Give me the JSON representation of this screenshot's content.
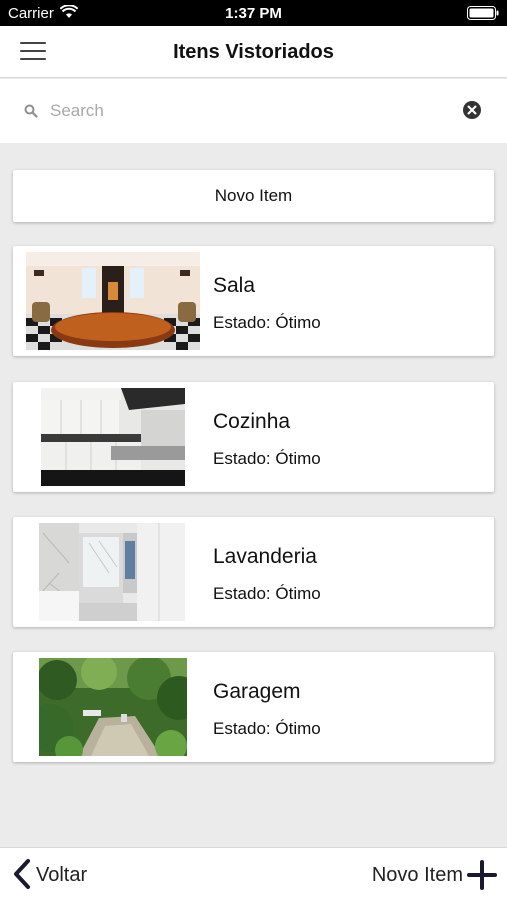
{
  "status_bar": {
    "carrier": "Carrier",
    "time": "1:37 PM"
  },
  "nav": {
    "title": "Itens Vistoriados",
    "menu_icon": "hamburger-menu-icon"
  },
  "search": {
    "placeholder": "Search",
    "value": ""
  },
  "new_item_button": "Novo Item",
  "items": [
    {
      "name": "Sala",
      "status": "Estado: Ótimo",
      "image": "living-room-photo"
    },
    {
      "name": "Cozinha",
      "status": "Estado: Ótimo",
      "image": "kitchen-photo"
    },
    {
      "name": "Lavanderia",
      "status": "Estado: Ótimo",
      "image": "laundry-photo"
    },
    {
      "name": "Garagem",
      "status": "Estado: Ótimo",
      "image": "garden-garage-photo"
    }
  ],
  "tab_bar": {
    "back_label": "Voltar",
    "new_item_label": "Novo Item"
  }
}
